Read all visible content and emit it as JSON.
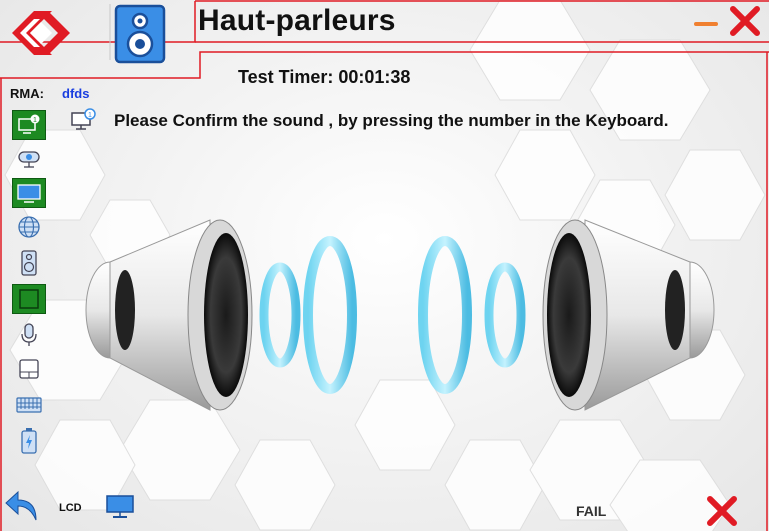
{
  "header": {
    "title": "Haut-parleurs",
    "logo_icon": "brand-logo-icon",
    "app_icon": "speaker-icon",
    "accent_color": "#e01b24",
    "icon_color": "#3a8ee6"
  },
  "timer": {
    "text": "Test Timer: 00:01:38"
  },
  "rma": {
    "label": "RMA:",
    "value": "dfds"
  },
  "instruction": "Please Confirm the sound , by pressing the number in the Keyboard.",
  "sidebar": {
    "items": [
      {
        "name": "system-info-icon",
        "active": true
      },
      {
        "name": "webcam-icon",
        "active": false
      },
      {
        "name": "display-icon",
        "active": true
      },
      {
        "name": "network-icon",
        "active": false
      },
      {
        "name": "speaker-icon",
        "active": false
      },
      {
        "name": "screen-test-icon",
        "active": true
      },
      {
        "name": "microphone-icon",
        "active": false
      },
      {
        "name": "touchpad-icon",
        "active": false
      },
      {
        "name": "keyboard-icon",
        "active": false
      },
      {
        "name": "battery-icon",
        "active": false
      }
    ],
    "active_color": "#1d8a22"
  },
  "bottom": {
    "back_icon": "back-arrow-icon",
    "lcd_label": "LCD",
    "lcd_icon": "monitor-icon",
    "fail_label": "FAIL",
    "fail_icon": "close-icon"
  }
}
